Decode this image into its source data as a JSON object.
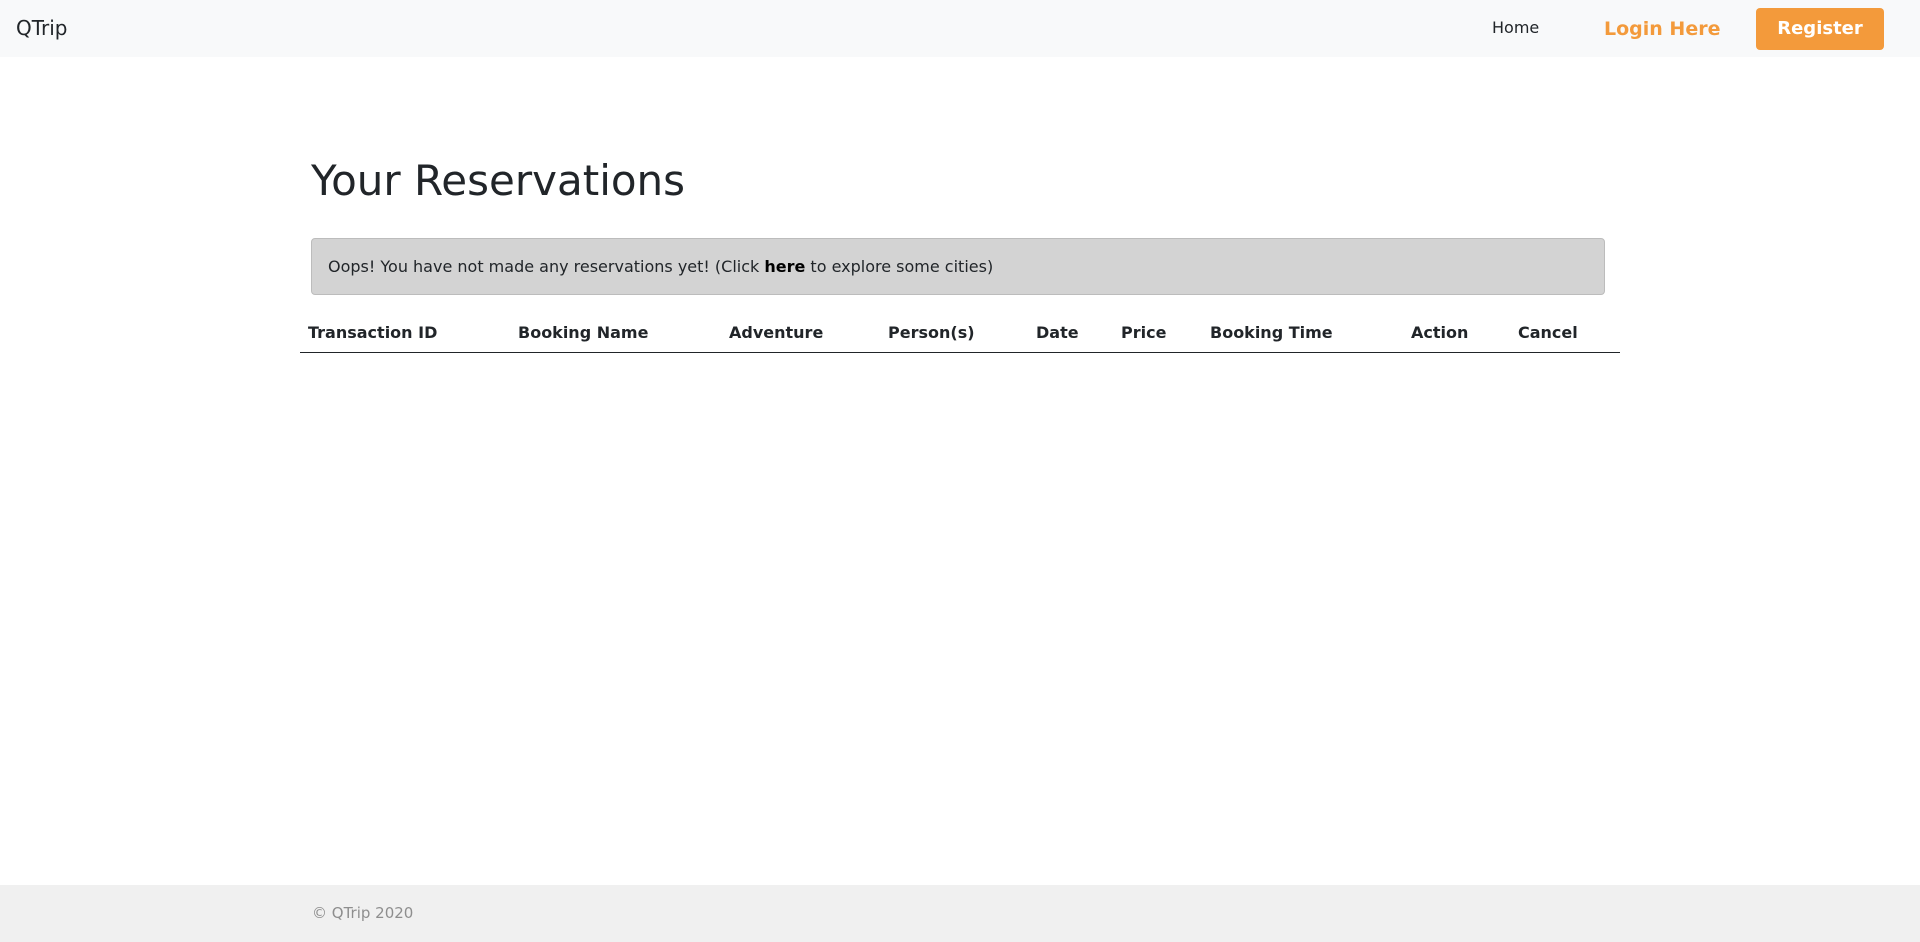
{
  "navbar": {
    "brand": "QTrip",
    "home_label": "Home",
    "login_label": "Login Here",
    "register_label": "Register"
  },
  "main": {
    "title": "Your Reservations",
    "alert": {
      "prefix": "Oops! You have not made any reservations yet! (Click ",
      "link_text": "here",
      "suffix": " to explore some cities)"
    },
    "table": {
      "columns": [
        "Transaction ID",
        "Booking Name",
        "Adventure",
        "Person(s)",
        "Date",
        "Price",
        "Booking Time",
        "Action",
        "Cancel"
      ],
      "rows": []
    }
  },
  "footer": {
    "text": "© QTrip 2020"
  },
  "colors": {
    "accent": "#f39a3b",
    "navbar_bg": "#f8f9fa",
    "alert_bg": "#d3d3d3",
    "footer_bg": "#f0f0f0"
  }
}
